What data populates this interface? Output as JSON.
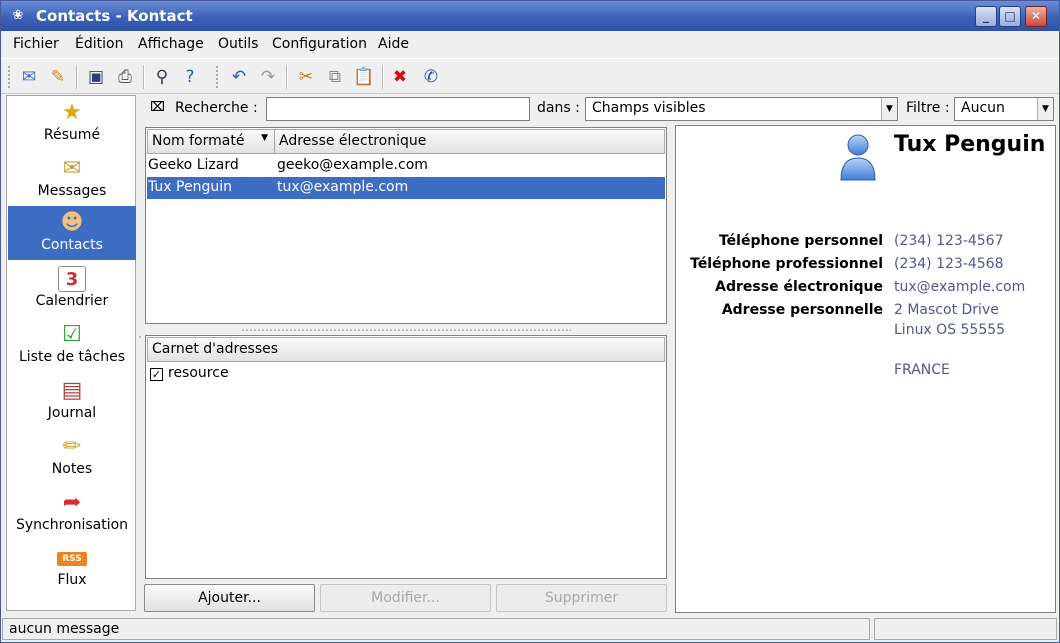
{
  "window": {
    "title": "Contacts - Kontact"
  },
  "menubar": {
    "items": [
      "Fichier",
      "Édition",
      "Affichage",
      "Outils",
      "Configuration",
      "Aide"
    ]
  },
  "toolbar": {
    "icons": [
      "new-contact-icon",
      "edit-icon",
      "save-icon",
      "print-icon",
      "search-icon",
      "whats-this-icon",
      "undo-icon",
      "redo-icon",
      "cut-icon",
      "copy-icon",
      "paste-icon",
      "delete-icon",
      "phone-icon"
    ]
  },
  "sidebar": {
    "items": [
      {
        "label": "Résumé",
        "icon": "summary-icon"
      },
      {
        "label": "Messages",
        "icon": "mail-icon"
      },
      {
        "label": "Contacts",
        "icon": "contacts-icon",
        "active": true
      },
      {
        "label": "Calendrier",
        "icon": "calendar-icon"
      },
      {
        "label": "Liste de tâches",
        "icon": "todo-icon"
      },
      {
        "label": "Journal",
        "icon": "journal-icon"
      },
      {
        "label": "Notes",
        "icon": "notes-icon"
      },
      {
        "label": "Synchronisation",
        "icon": "sync-icon"
      },
      {
        "label": "Flux",
        "icon": "rss-icon"
      }
    ]
  },
  "search": {
    "label": "Recherche :",
    "value": "",
    "in_label": "dans :",
    "in_value": "Champs visibles",
    "filter_label": "Filtre :",
    "filter_value": "Aucun"
  },
  "contacts": {
    "columns": [
      "Nom formaté",
      "Adresse électronique"
    ],
    "rows": [
      {
        "name": "Geeko Lizard",
        "email": "geeko@example.com",
        "selected": false
      },
      {
        "name": "Tux Penguin",
        "email": "tux@example.com",
        "selected": true
      }
    ]
  },
  "addressbooks": {
    "header": "Carnet d'adresses",
    "items": [
      {
        "label": "resource",
        "checked": true
      }
    ]
  },
  "buttons": {
    "add": "Ajouter...",
    "edit": "Modifier...",
    "remove": "Supprimer"
  },
  "details": {
    "name": "Tux Penguin",
    "fields": [
      {
        "label": "Téléphone personnel",
        "value": "(234) 123-4567"
      },
      {
        "label": "Téléphone professionnel",
        "value": "(234) 123-4568"
      },
      {
        "label": "Adresse électronique",
        "value": "tux@example.com"
      },
      {
        "label": "Adresse personnelle",
        "value": "2 Mascot Drive"
      }
    ],
    "address_line2": "Linux OS 55555",
    "country": "FRANCE"
  },
  "status": {
    "message": "aucun message"
  },
  "colors": {
    "selection": "#3c6dc3",
    "title_bar": "#3c61b8",
    "link_value": "#545497"
  }
}
